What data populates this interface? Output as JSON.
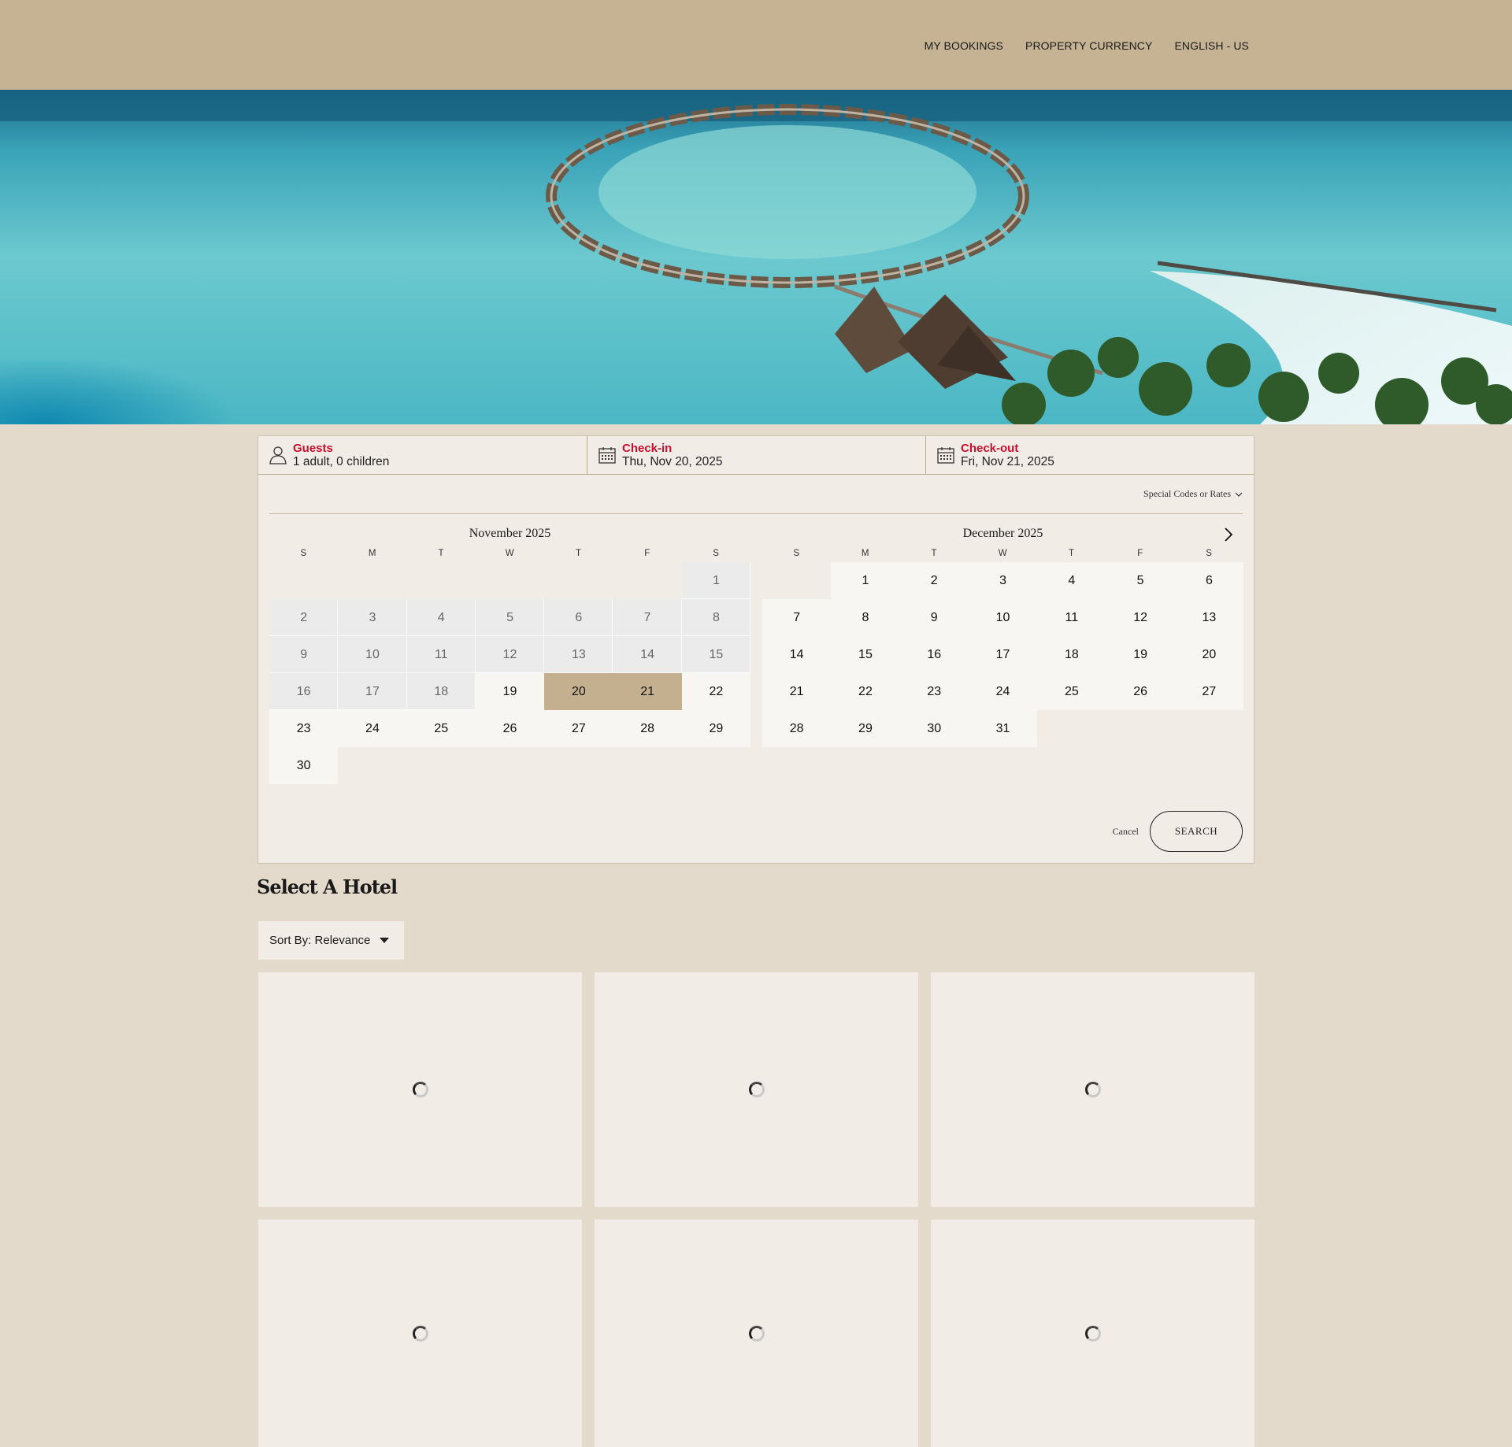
{
  "nav": {
    "my_bookings": "MY BOOKINGS",
    "property_currency": "PROPERTY CURRENCY",
    "language": "ENGLISH - US"
  },
  "hero": {
    "icon": "overwater-villas-image"
  },
  "search": {
    "guests": {
      "label": "Guests",
      "value": "1 adult, 0 children"
    },
    "checkin": {
      "label": "Check-in",
      "value": "Thu, Nov 20, 2025"
    },
    "checkout": {
      "label": "Check-out",
      "value": "Fri, Nov 21, 2025"
    },
    "special_codes": "Special Codes or Rates",
    "cancel": "Cancel",
    "search_button": "SEARCH"
  },
  "calendar": {
    "weekday_headers": [
      "S",
      "M",
      "T",
      "W",
      "T",
      "F",
      "S"
    ],
    "months": [
      {
        "title": "November 2025",
        "leading_blanks": 6,
        "days": 30,
        "past_through": 18,
        "selected": [
          20,
          21
        ]
      },
      {
        "title": "December 2025",
        "leading_blanks": 1,
        "days": 31,
        "past_through": 0,
        "selected": []
      }
    ]
  },
  "hotels": {
    "title": "Select A Hotel",
    "sort_label": "Sort By: Relevance",
    "card_count": 6
  },
  "colors": {
    "header": "#c5b394",
    "page": "#e3dacb",
    "accent_label": "#c8102e",
    "selected_day": "#c4b08e"
  }
}
